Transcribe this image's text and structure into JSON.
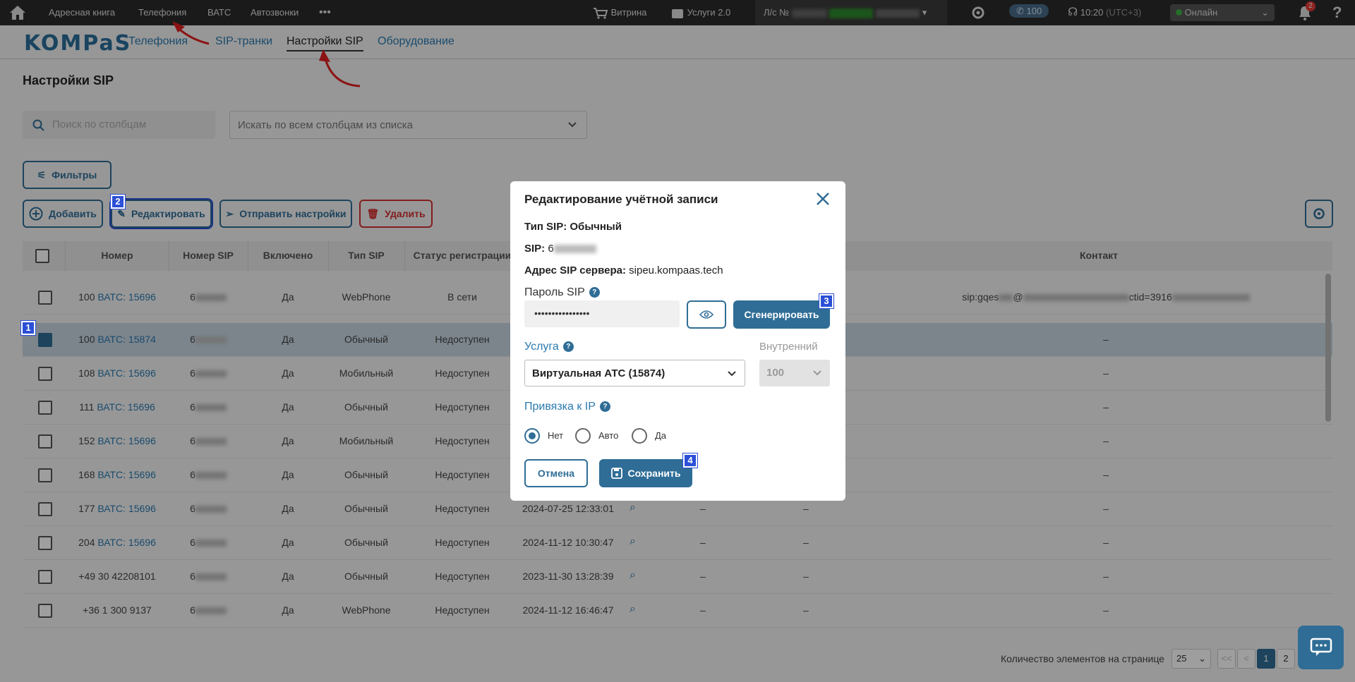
{
  "topbar": {
    "menu": [
      "Адресная книга",
      "Телефония",
      "ВАТС",
      "Автозвонки"
    ],
    "more": "•••",
    "shop": "Витрина",
    "services": "Услуги 2.0",
    "account_prefix": "Л/с №",
    "calls_count": "100",
    "time": "10:20",
    "timezone": "(UTC+3)",
    "status": "Онлайн",
    "notifications": "2",
    "help": "?"
  },
  "nav": {
    "logo": "KOMPaS",
    "tabs": [
      "Телефония",
      "SIP-транки",
      "Настройки SIP",
      "Оборудование"
    ]
  },
  "page": {
    "title": "Настройки SIP",
    "search_placeholder": "Поиск по столбцам",
    "search_scope": "Искать по всем столбцам из списка",
    "filters": "Фильтры",
    "add": "Добавить",
    "edit": "Редактировать",
    "send_settings": "Отправить настройки",
    "delete": "Удалить"
  },
  "table": {
    "headers": [
      "Номер",
      "Номер SIP",
      "Включено",
      "Тип SIP",
      "Статус регистрации",
      "Контакт"
    ],
    "rows": [
      {
        "num": "100",
        "vats": "ВАТС: 15696",
        "sip": "6",
        "on": "Да",
        "type": "WebPhone",
        "status": "В сети",
        "date": "",
        "contact": "sip:gqes",
        "contact_mid": "@",
        "contact_end": "ctid=3916"
      },
      {
        "num": "100",
        "vats": "ВАТС: 15874",
        "sip": "6",
        "on": "Да",
        "type": "Обычный",
        "status": "Недоступен",
        "date": "",
        "contact": "–",
        "contact_mid": "",
        "contact_end": ""
      },
      {
        "num": "108",
        "vats": "ВАТС: 15696",
        "sip": "6",
        "on": "Да",
        "type": "Мобильный",
        "status": "Недоступен",
        "date": "",
        "contact": "–",
        "contact_mid": "",
        "contact_end": ""
      },
      {
        "num": "111",
        "vats": "ВАТС: 15696",
        "sip": "6",
        "on": "Да",
        "type": "Обычный",
        "status": "Недоступен",
        "date": "",
        "contact": "–",
        "contact_mid": "",
        "contact_end": ""
      },
      {
        "num": "152",
        "vats": "ВАТС: 15696",
        "sip": "6",
        "on": "Да",
        "type": "Мобильный",
        "status": "Недоступен",
        "date": "",
        "contact": "–",
        "contact_mid": "",
        "contact_end": ""
      },
      {
        "num": "168",
        "vats": "ВАТС: 15696",
        "sip": "6",
        "on": "Да",
        "type": "Обычный",
        "status": "Недоступен",
        "date": "",
        "contact": "–",
        "contact_mid": "",
        "contact_end": ""
      },
      {
        "num": "177",
        "vats": "ВАТС: 15696",
        "sip": "6",
        "on": "Да",
        "type": "Обычный",
        "status": "Недоступен",
        "date": "2024-07-25 12:33:01",
        "contact": "–",
        "contact_mid": "",
        "contact_end": ""
      },
      {
        "num": "204",
        "vats": "ВАТС: 15696",
        "sip": "6",
        "on": "Да",
        "type": "Обычный",
        "status": "Недоступен",
        "date": "2024-11-12 10:30:47",
        "contact": "–",
        "contact_mid": "",
        "contact_end": ""
      },
      {
        "num": "+49 30 42208101",
        "vats": "",
        "sip": "6",
        "on": "Да",
        "type": "Обычный",
        "status": "Недоступен",
        "date": "2023-11-30 13:28:39",
        "contact": "–",
        "contact_mid": "",
        "contact_end": ""
      },
      {
        "num": "+36 1 300 9137",
        "vats": "",
        "sip": "6",
        "on": "Да",
        "type": "WebPhone",
        "status": "Недоступен",
        "date": "2024-11-12 16:46:47",
        "contact": "–",
        "contact_mid": "",
        "contact_end": ""
      }
    ],
    "dash": "–"
  },
  "pagination": {
    "label": "Количество элементов на странице",
    "per_page": "25",
    "first": "<<",
    "prev": "<",
    "pages": [
      "1",
      "2"
    ]
  },
  "modal": {
    "title": "Редактирование учётной записи",
    "sip_type": "Тип SIP: Обычный",
    "sip_label": "SIP:",
    "sip_value": "6",
    "server_label": "Адрес SIP сервера:",
    "server_value": "sipeu.kompaas.tech",
    "password_label": "Пароль SIP",
    "password_value": "••••••••••••••••",
    "generate": "Сгенерировать",
    "service_label": "Услуга",
    "service_value": "Виртуальная АТС (15874)",
    "internal_label": "Внутренний",
    "internal_value": "100",
    "ip_label": "Привязка к IP",
    "ip_options": [
      "Нет",
      "Авто",
      "Да"
    ],
    "cancel": "Отмена",
    "save": "Сохранить"
  },
  "annotations": [
    "1",
    "2",
    "3",
    "4"
  ],
  "colors": {
    "accent": "#2f6d96",
    "link": "#2a7ab0",
    "danger": "#d32f2f",
    "badge": "#2b4fd6",
    "topbar": "#2b2b2b"
  }
}
